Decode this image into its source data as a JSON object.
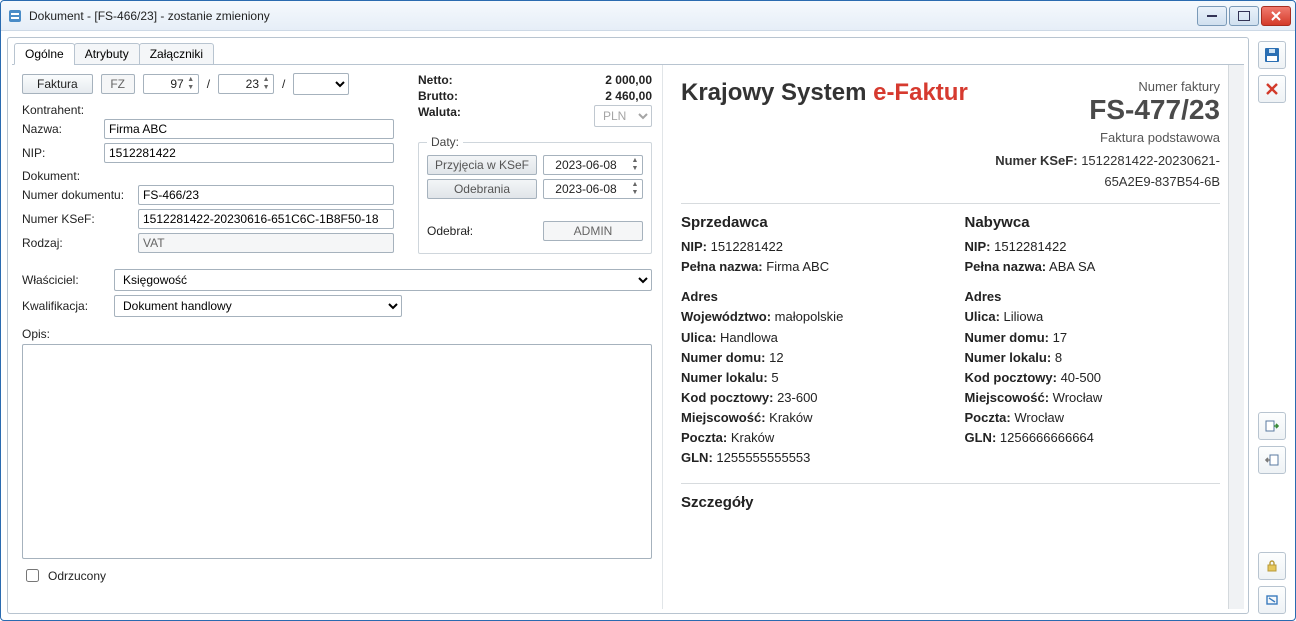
{
  "window": {
    "title": "Dokument - [FS-466/23] - zostanie zmieniony"
  },
  "tabs": {
    "ogolne": "Ogólne",
    "atrybuty": "Atrybuty",
    "zalaczniki": "Załączniki"
  },
  "form": {
    "faktura_btn": "Faktura",
    "prefix": "FZ",
    "num_a": "97",
    "num_b": "23",
    "sep": "/",
    "kontrahent": {
      "section": "Kontrahent:",
      "nazwa_label": "Nazwa:",
      "nazwa": "Firma ABC",
      "nip_label": "NIP:",
      "nip": "1512281422"
    },
    "dokument": {
      "section": "Dokument:",
      "numdoc_label": "Numer dokumentu:",
      "numdoc": "FS-466/23",
      "ksef_label": "Numer KSeF:",
      "ksef": "1512281422-20230616-651C6C-1B8F50-18",
      "rodzaj_label": "Rodzaj:",
      "rodzaj": "VAT"
    },
    "wlasciciel_label": "Właściciel:",
    "wlasciciel": "Księgowość",
    "kwalifikacja_label": "Kwalifikacja:",
    "kwalifikacja": "Dokument handlowy",
    "opis_label": "Opis:",
    "opis": "",
    "odrzucony_label": "Odrzucony"
  },
  "totals": {
    "netto_label": "Netto:",
    "netto": "2 000,00",
    "brutto_label": "Brutto:",
    "brutto": "2 460,00",
    "waluta_label": "Waluta:",
    "waluta": "PLN"
  },
  "dates": {
    "legend": "Daty:",
    "przyjecia_btn": "Przyjęcia w KSeF",
    "przyjecia": "2023-06-08",
    "odebrania_btn": "Odebrania",
    "odebrania": "2023-06-08",
    "odebral_label": "Odebrał:",
    "odebral": "ADMIN"
  },
  "preview": {
    "title_a": "Krajowy System ",
    "title_b": "e-Faktur",
    "numer_faktury_l": "Numer faktury",
    "numer_faktury": "FS-477/23",
    "podtyp": "Faktura podstawowa",
    "ksef_l": "Numer KSeF:",
    "ksef_v1": "1512281422-20230621-",
    "ksef_v2": "65A2E9-837B54-6B",
    "sprzedawca": {
      "head": "Sprzedawca",
      "nip_l": "NIP:",
      "nip": "1512281422",
      "pn_l": "Pełna nazwa:",
      "pn": "Firma ABC",
      "adres": "Adres",
      "woj_l": "Województwo:",
      "woj": "małopolskie",
      "ul_l": "Ulica:",
      "ul": "Handlowa",
      "nd_l": "Numer domu:",
      "nd": "12",
      "nl_l": "Numer lokalu:",
      "nl": "5",
      "kp_l": "Kod pocztowy:",
      "kp": "23-600",
      "mj_l": "Miejscowość:",
      "mj": "Kraków",
      "pz_l": "Poczta:",
      "pz": "Kraków",
      "gln_l": "GLN:",
      "gln": "1255555555553"
    },
    "nabywca": {
      "head": "Nabywca",
      "nip_l": "NIP:",
      "nip": "1512281422",
      "pn_l": "Pełna nazwa:",
      "pn": "ABA SA",
      "adres": "Adres",
      "ul_l": "Ulica:",
      "ul": "Liliowa",
      "nd_l": "Numer domu:",
      "nd": "17",
      "nl_l": "Numer lokalu:",
      "nl": "8",
      "kp_l": "Kod pocztowy:",
      "kp": "40-500",
      "mj_l": "Miejscowość:",
      "mj": "Wrocław",
      "pz_l": "Poczta:",
      "pz": "Wrocław",
      "gln_l": "GLN:",
      "gln": "1256666666664"
    },
    "szczegoly": "Szczegóły"
  }
}
